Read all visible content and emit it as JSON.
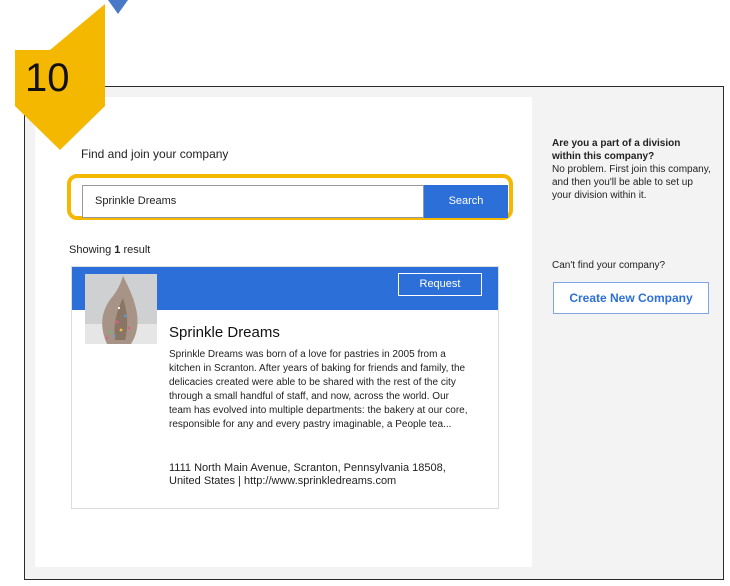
{
  "step": {
    "number": "10",
    "badge_color": "#f5b800"
  },
  "main": {
    "title": "Find and join your company",
    "search": {
      "value": "Sprinkle Dreams",
      "button_label": "Search",
      "highlight_color": "#f5b800"
    },
    "results": {
      "showing_prefix": "Showing",
      "count": "1",
      "suffix": "result"
    },
    "result_card": {
      "request_label": "Request",
      "name": "Sprinkle Dreams",
      "description": "Sprinkle Dreams was born of a love for pastries in 2005 from a kitchen in Scranton. After years of baking for friends and family, the delicacies created were able to be shared with the rest of the city through a small handful of staff, and now, across the world. Our team has evolved into multiple departments: the bakery at our core, responsible for any and every pastry imaginable, a People tea...",
      "address": "1111 North Main Avenue, Scranton, Pennsylvania 18508, United States | http://www.sprinkledreams.com"
    }
  },
  "sidebar": {
    "division_question": "Are you a part of a division within this company?",
    "division_text": "No problem. First join this company, and then you'll be able to set up your division within it.",
    "cant_find": "Can't find your company?",
    "create_label": "Create New Company"
  },
  "colors": {
    "accent": "#2d6fd8",
    "badge": "#f5b800"
  }
}
